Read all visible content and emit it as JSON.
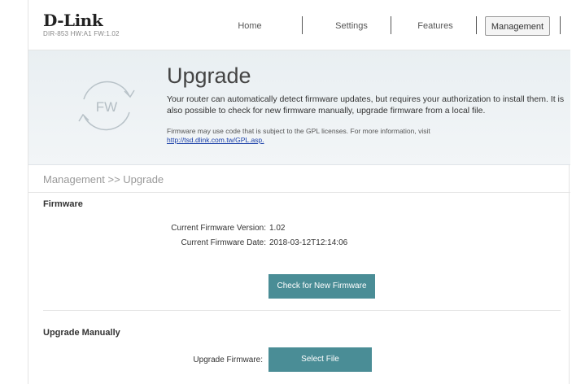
{
  "header": {
    "brand": "D-Link",
    "model_info": "DIR-853 HW:A1 FW:1.02",
    "nav": [
      {
        "label": "Home",
        "active": false
      },
      {
        "label": "Settings",
        "active": false
      },
      {
        "label": "Features",
        "active": false
      },
      {
        "label": "Management",
        "active": true
      }
    ]
  },
  "banner": {
    "icon_text": "FW",
    "title": "Upgrade",
    "description": "Your router can automatically detect firmware updates, but requires your authorization to install them. It is also possible to check for new firmware manually, upgrade firmware from a local file.",
    "note": "Firmware may use code that is subject to the GPL licenses. For more information, visit",
    "link": "http://tsd.dlink.com.tw/GPL.asp."
  },
  "breadcrumb": "Management >> Upgrade",
  "firmware": {
    "title": "Firmware",
    "version_label": "Current Firmware Version:",
    "version_value": "1.02",
    "date_label": "Current Firmware Date:",
    "date_value": "2018-03-12T12:14:06",
    "check_button": "Check for New Firmware"
  },
  "manual": {
    "title": "Upgrade Manually",
    "upgrade_label": "Upgrade Firmware:",
    "select_button": "Select File"
  },
  "colors": {
    "accent": "#4a8d96",
    "link": "#1a3fa8"
  }
}
